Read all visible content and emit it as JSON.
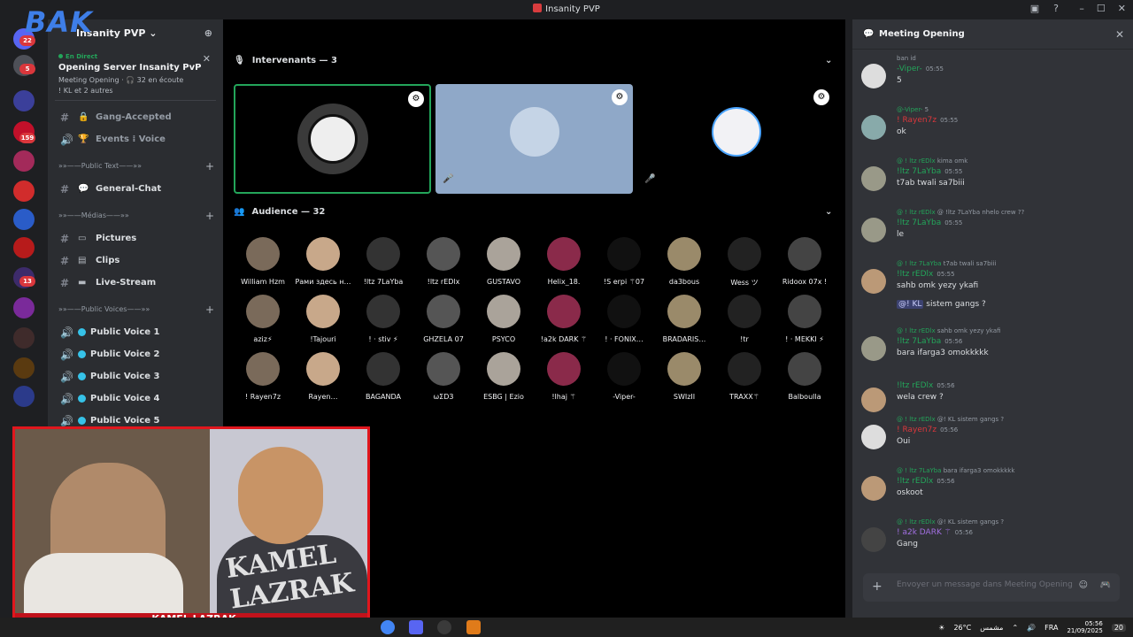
{
  "window": {
    "title": "Insanity PVP"
  },
  "overlay": {
    "logo_text": "BAK",
    "webcam_watermark": "KAMEL LAZRAK",
    "webcam_banner": "KAMEL LAZRAK"
  },
  "guild": {
    "name": "Insanity PVP"
  },
  "live": {
    "tag": "En Direct",
    "title": "Opening Server Insanity PvP",
    "meta1": "Meeting Opening · 🎧 32 en écoute",
    "meta2": "! KL et 2 autres"
  },
  "channels": [
    {
      "label": "Gang-Accepted",
      "emoji": "🔒"
    },
    {
      "label": "Events ⁞ Voice",
      "emoji": "🏆"
    }
  ],
  "categories": {
    "text": "»»——Public Text——»»",
    "medias": "»»——Médias——»»",
    "voices": "»»——Public Voices——»»"
  },
  "text_channels": [
    {
      "label": "General-Chat"
    }
  ],
  "media_channels": [
    {
      "label": "Pictures"
    },
    {
      "label": "Clips"
    },
    {
      "label": "Live-Stream"
    }
  ],
  "voice_channels": [
    {
      "label": "Public Voice 1"
    },
    {
      "label": "Public Voice 2"
    },
    {
      "label": "Public Voice 3"
    },
    {
      "label": "Public Voice 4"
    },
    {
      "label": "Public Voice 5"
    }
  ],
  "stage": {
    "speakers_header": "Intervenants — 3",
    "audience_header": "Audience — 32"
  },
  "audience": [
    "William Hzm",
    "Рами здесь н…",
    "!ltz 7LaYba",
    "!ltz rEDlx",
    "GUSTAVO",
    "Helix_18.",
    "!S erpi ⚚07",
    "da3bous",
    "Wess ツ",
    "Ridoox 07x !",
    "aziz⚡",
    "!Tajouri",
    "! · stiv ⚡",
    "GHZELA 07",
    "PSYCO",
    "!a2k DARK ⚚",
    "! · FONIX…",
    "BRADARIS…",
    "!tr",
    "! · MEKKI ⚡",
    "! Rayen7z",
    "Rayen…",
    "BAGANDA",
    "ωΣD3",
    "ESBG | Ezio",
    "!lhaj ⚚",
    "-Viper-",
    "SWIzII",
    "TRAXX⚚",
    "Balboulla"
  ],
  "chat": {
    "title": "Meeting Opening",
    "messages": [
      {
        "reply_user": "",
        "reply_text": "ban id",
        "author": "-Viper-",
        "author_color": "#23a55a",
        "time": "05:55",
        "body": "5"
      },
      {
        "reply_user": "@-Viper-",
        "reply_text": "5",
        "author": "! Rayen7z",
        "author_color": "#da373c",
        "time": "05:55",
        "body": "ok"
      },
      {
        "reply_user": "@ ! ltz rEDlx",
        "reply_text": "kima omk",
        "author": "!ltz 7LaYba",
        "author_color": "#23a55a",
        "time": "05:55",
        "body": "t7ab twali sa7biii"
      },
      {
        "reply_user": "@ ! ltz rEDlx",
        "reply_text": "@ !ltz 7LaYba nhelo crew ??",
        "author": "!ltz 7LaYba",
        "author_color": "#23a55a",
        "time": "05:55",
        "body": "le"
      },
      {
        "reply_user": "@ ! ltz 7LaYba",
        "reply_text": "t7ab twali sa7biii",
        "author": "!ltz rEDlx",
        "author_color": "#23a55a",
        "time": "05:55",
        "body": "sahb omk yezy ykafi"
      },
      {
        "reply_user": "",
        "reply_text": "",
        "author": "",
        "author_color": "#23a55a",
        "time": "",
        "body_mention": "@! KL",
        "body": "sistem gangs ?"
      },
      {
        "reply_user": "@ ! ltz rEDlx",
        "reply_text": "sahb omk yezy ykafi",
        "author": "!ltz 7LaYba",
        "author_color": "#23a55a",
        "time": "05:56",
        "body": "bara ifarga3 omokkkkk"
      },
      {
        "reply_user": "",
        "reply_text": "",
        "author": "!ltz rEDlx",
        "author_color": "#23a55a",
        "time": "05:56",
        "body": "wela crew ?"
      },
      {
        "reply_user": "@ ! ltz rEDlx",
        "reply_text": "@! KL sistem gangs ?",
        "author": "! Rayen7z",
        "author_color": "#da373c",
        "time": "05:56",
        "body": "Oui"
      },
      {
        "reply_user": "@ ! ltz 7LaYba",
        "reply_text": "bara ifarga3 omokkkkk",
        "author": "!ltz rEDlx",
        "author_color": "#23a55a",
        "time": "05:56",
        "body": "oskoot"
      },
      {
        "reply_user": "@ ! ltz rEDlx",
        "reply_text": "@! KL sistem gangs ?",
        "author": "! a2k DARK ⚚",
        "author_color": "#a16fe0",
        "time": "05:56",
        "body": "Gang"
      }
    ],
    "input_placeholder": "Envoyer un message dans Meeting Opening"
  },
  "taskbar": {
    "weather": "26°C",
    "weather_label": "مشمس",
    "lang": "FRA",
    "time": "05:56",
    "date": "21/09/2025",
    "notif": "20"
  }
}
